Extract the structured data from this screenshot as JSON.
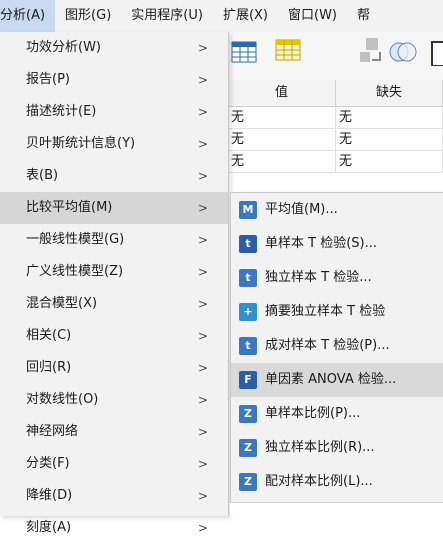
{
  "menubar": {
    "items": [
      {
        "label": "分析(A)"
      },
      {
        "label": "图形(G)"
      },
      {
        "label": "实用程序(U)"
      },
      {
        "label": "扩展(X)"
      },
      {
        "label": "窗口(W)"
      },
      {
        "label": "帮"
      }
    ]
  },
  "analyze_menu": {
    "items": [
      {
        "label": "功效分析(W)"
      },
      {
        "label": "报告(P)"
      },
      {
        "label": "描述统计(E)"
      },
      {
        "label": "贝叶斯统计信息(Y)"
      },
      {
        "label": "表(B)"
      },
      {
        "label": "比较平均值(M)"
      },
      {
        "label": "一般线性模型(G)"
      },
      {
        "label": "广义线性模型(Z)"
      },
      {
        "label": "混合模型(X)"
      },
      {
        "label": "相关(C)"
      },
      {
        "label": "回归(R)"
      },
      {
        "label": "对数线性(O)"
      },
      {
        "label": "神经网络"
      },
      {
        "label": "分类(F)"
      },
      {
        "label": "降维(D)"
      },
      {
        "label": "刻度(A)"
      }
    ],
    "arrow": ">"
  },
  "compare_means_submenu": {
    "items": [
      {
        "label": "平均值(M)...",
        "icon": "M"
      },
      {
        "label": "单样本 T 检验(S)...",
        "icon": "t"
      },
      {
        "label": "独立样本 T 检验...",
        "icon": "t"
      },
      {
        "label": "摘要独立样本 T 检验",
        "icon": "+"
      },
      {
        "label": "成对样本 T 检验(P)...",
        "icon": "t"
      },
      {
        "label": "单因素 ANOVA 检验...",
        "icon": "F"
      },
      {
        "label": "单样本比例(P)...",
        "icon": "Z"
      },
      {
        "label": "独立样本比例(R)...",
        "icon": "Z"
      },
      {
        "label": "配对样本比例(L)...",
        "icon": "Z"
      }
    ]
  },
  "data_grid": {
    "headers": [
      "值",
      "缺失"
    ],
    "rows": [
      [
        "无",
        "无"
      ],
      [
        "无",
        "无"
      ],
      [
        "无",
        "无"
      ]
    ]
  },
  "colors": {
    "menu_bg": "#f2f2f2",
    "highlight": "#d6d6d6",
    "menubar_active": "#c8d9f0",
    "icon_blue": "#3a78c2"
  }
}
